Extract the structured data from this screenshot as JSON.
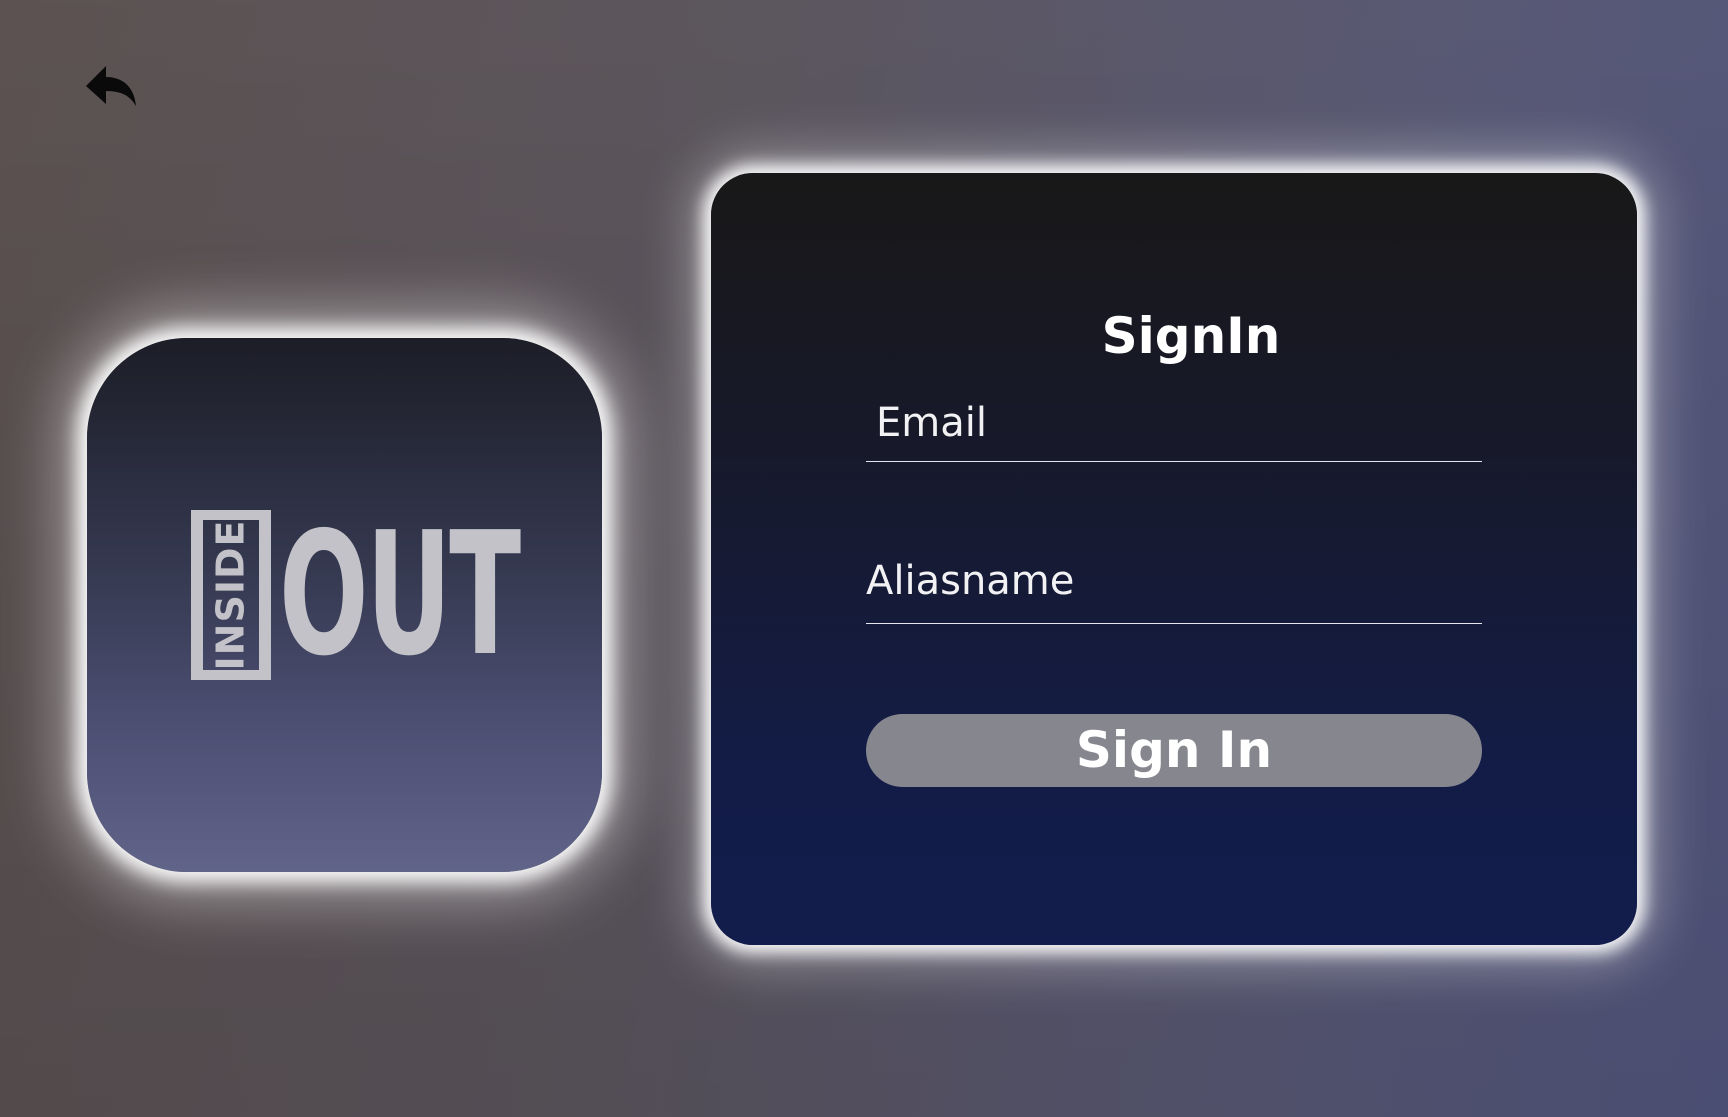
{
  "navigation": {
    "back_icon": "back-arrow-icon"
  },
  "logo": {
    "inside_text": "INSIDE",
    "out_text": "OUT",
    "color": "#c2c2c8"
  },
  "signin": {
    "title": "SignIn",
    "email_placeholder": "Email",
    "email_value": "",
    "alias_placeholder": "Aliasname",
    "alias_value": "",
    "button_label": "Sign In",
    "button_color": "#86868f"
  }
}
